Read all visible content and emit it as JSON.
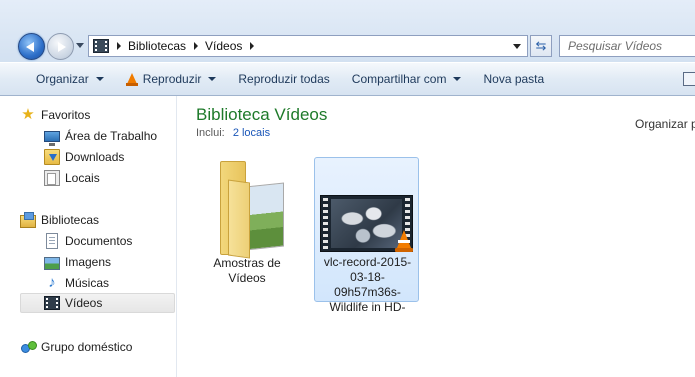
{
  "address": {
    "crumbs": [
      "Bibliotecas",
      "Vídeos"
    ],
    "search_placeholder": "Pesquisar Vídeos"
  },
  "toolbar": {
    "organize": "Organizar",
    "play": "Reproduzir",
    "play_all": "Reproduzir todas",
    "share": "Compartilhar com",
    "new_folder": "Nova pasta"
  },
  "nav": {
    "favorites": "Favoritos",
    "desktop": "Área de Trabalho",
    "downloads": "Downloads",
    "places": "Locais",
    "libraries": "Bibliotecas",
    "documents": "Documentos",
    "images": "Imagens",
    "music": "Músicas",
    "videos": "Vídeos",
    "homegroup": "Grupo doméstico"
  },
  "content": {
    "title": "Biblioteca Vídeos",
    "includes_label": "Inclui:",
    "includes_link": "2 locais",
    "arrange_by": "Organizar p",
    "items": [
      {
        "name": "Amostras de Vídeos",
        "type": "folder"
      },
      {
        "name": "vlc-record-2015-03-18-09h57m36s-Wildlife in HD-",
        "type": "video"
      }
    ]
  },
  "icons": {
    "back": "back-arrow-icon",
    "forward": "forward-arrow-icon",
    "refresh": "refresh-icon",
    "vlc": "vlc-cone-icon"
  }
}
